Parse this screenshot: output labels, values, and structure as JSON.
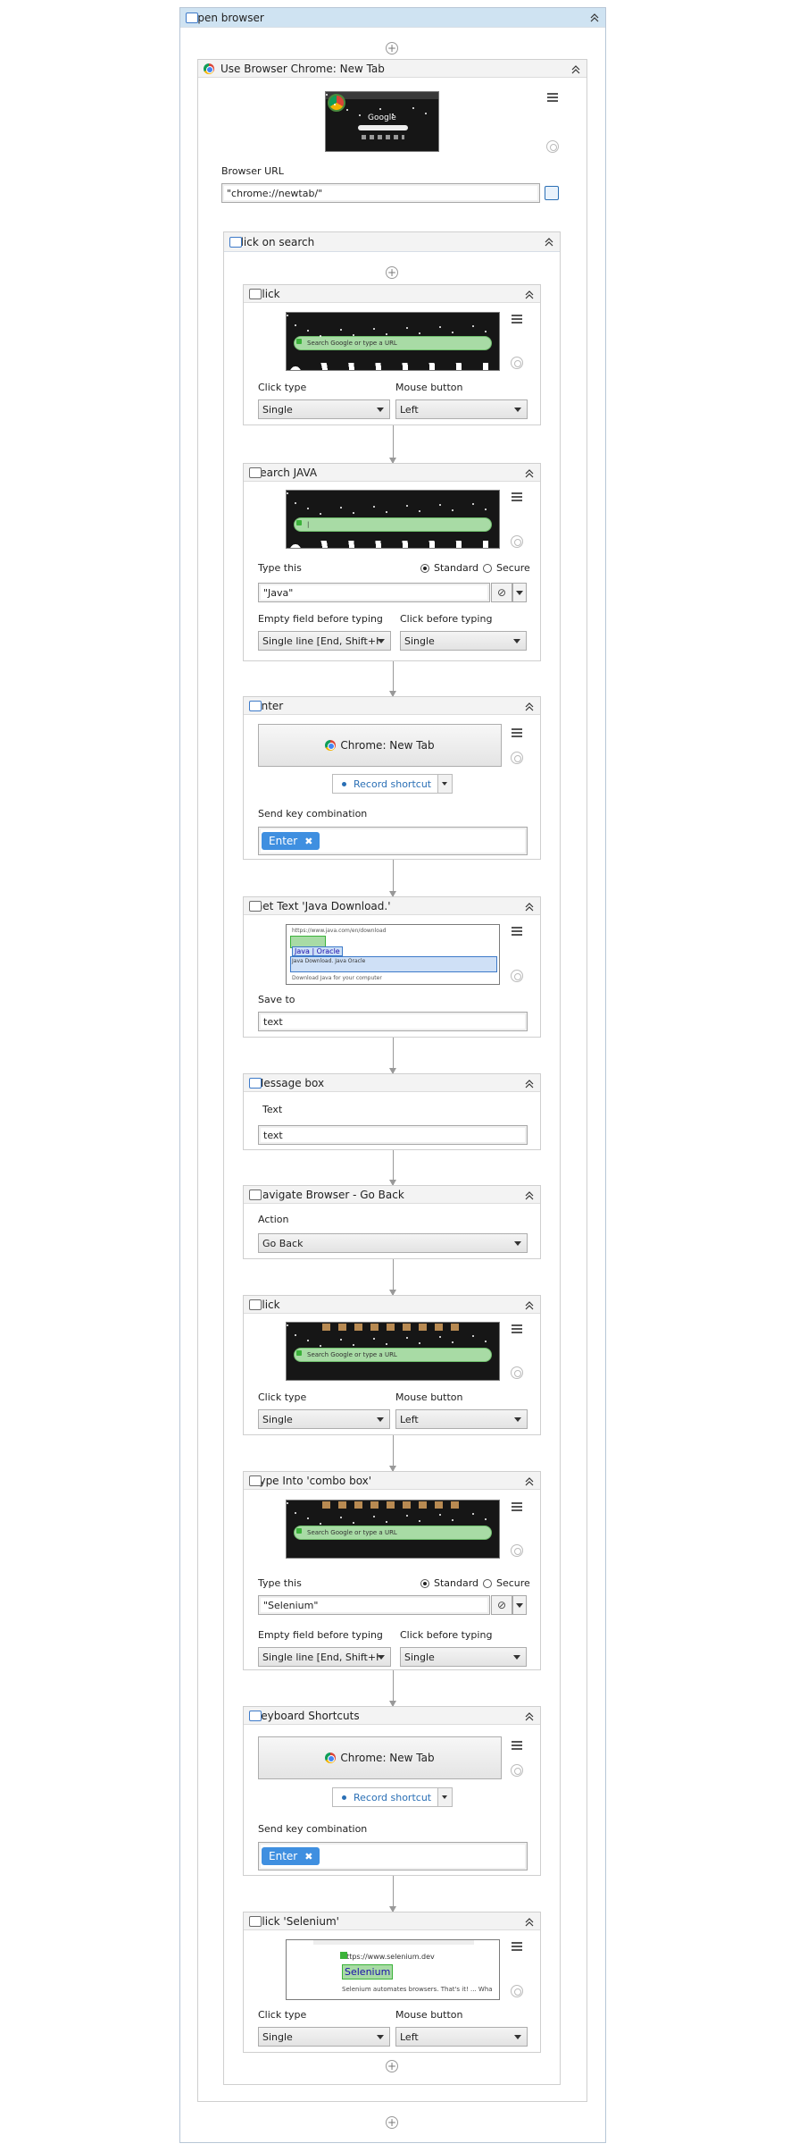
{
  "outer": {
    "title": "open browser"
  },
  "browser": {
    "title": "Use Browser Chrome: New Tab",
    "url_label": "Browser URL",
    "url_value": "\"chrome://newtab/\"",
    "logo_text": "Google"
  },
  "inner": {
    "title": "click on search"
  },
  "actions": {
    "click1": {
      "title": "Click",
      "search_text": "Search Google or type a URL",
      "click_type_label": "Click type",
      "click_type_value": "Single",
      "mouse_label": "Mouse button",
      "mouse_value": "Left"
    },
    "type1": {
      "title": "search JAVA",
      "type_label": "Type this",
      "type_value": "\"Java\"",
      "standard": "Standard",
      "secure": "Secure",
      "empty_label": "Empty field before typing",
      "empty_value": "Single line [End, Shift+H",
      "clickb_label": "Click before typing",
      "clickb_value": "Single"
    },
    "enter": {
      "title": "Enter",
      "target": "Chrome: New Tab",
      "record": "Record shortcut",
      "combo_label": "Send key combination",
      "key": "Enter"
    },
    "gettext": {
      "title": "Get Text 'Java Download.'",
      "save_label": "Save to",
      "save_value": "text",
      "shot_line1": "https://www.java.com/en/download",
      "shot_tag1": "Java | Oracle",
      "shot_line2": "Java Download. Java Oracle",
      "shot_line3": "Download Java for your computer"
    },
    "msgbox": {
      "title": "Message box",
      "text_label": "Text",
      "text_value": "text"
    },
    "navigate": {
      "title": "Navigate Browser - Go Back",
      "action_label": "Action",
      "action_value": "Go Back"
    },
    "click2": {
      "title": "Click",
      "search_text": "Search Google or type a URL",
      "click_type_label": "Click type",
      "click_type_value": "Single",
      "mouse_label": "Mouse button",
      "mouse_value": "Left"
    },
    "type2": {
      "title": "Type Into 'combo box'",
      "search_text": "Search Google or type a URL",
      "type_label": "Type this",
      "type_value": "\"Selenium\"",
      "standard": "Standard",
      "secure": "Secure",
      "empty_label": "Empty field before typing",
      "empty_value": "Single line [End, Shift+H",
      "clickb_label": "Click before typing",
      "clickb_value": "Single"
    },
    "keyboard": {
      "title": "Keyboard Shortcuts",
      "target": "Chrome: New Tab",
      "record": "Record shortcut",
      "combo_label": "Send key combination",
      "key": "Enter"
    },
    "click3": {
      "title": "Click 'Selenium'",
      "shot_url": "https://www.selenium.dev",
      "shot_link": "Selenium",
      "shot_desc": "Selenium automates browsers. That's it! ... Wha",
      "click_type_label": "Click type",
      "click_type_value": "Single",
      "mouse_label": "Mouse button",
      "mouse_value": "Left"
    }
  }
}
